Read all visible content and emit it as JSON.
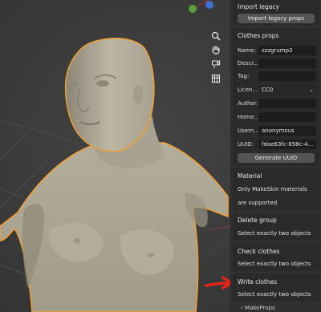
{
  "panel": {
    "import_legacy": {
      "title": "Import legacy",
      "button": "Import legacy props"
    },
    "clothes_props": {
      "title": "Clothes props",
      "fields": [
        {
          "label": "Name:",
          "value": "zzzgrump3"
        },
        {
          "label": "Descr...",
          "value": ""
        },
        {
          "label": "Tag:",
          "value": ""
        },
        {
          "label": "Licen...",
          "value": "CC0",
          "dropdown": true
        },
        {
          "label": "Author:",
          "value": ""
        },
        {
          "label": "Home...",
          "value": ""
        },
        {
          "label": "Usern...",
          "value": "anonymous"
        },
        {
          "label": "UUID:",
          "value": "fdae63fc-858c-4..."
        }
      ],
      "generate_button": "Generate UUID"
    },
    "material": {
      "title": "Material",
      "line1": "Only MakeSkin materials",
      "line2": "are supported"
    },
    "delete_group": {
      "title": "Delete group",
      "note": "Select exactly two objects"
    },
    "check_clothes": {
      "title": "Check clothes",
      "note": "Select exactly two objects"
    },
    "write_clothes": {
      "title": "Write clothes",
      "note": "Select exactly two objects"
    },
    "makeprops": {
      "label": "MakeProps"
    }
  },
  "viewport": {
    "gizmo_icons": [
      "axis-green-y-icon",
      "axis-x-line-icon",
      "axis-blue-z-icon"
    ],
    "nav_icons": [
      "zoom-icon",
      "pan-hand-icon",
      "camera-icon",
      "grid-view-icon"
    ],
    "annotation_color": "#e8231a",
    "outline_color": "#f0a030"
  }
}
